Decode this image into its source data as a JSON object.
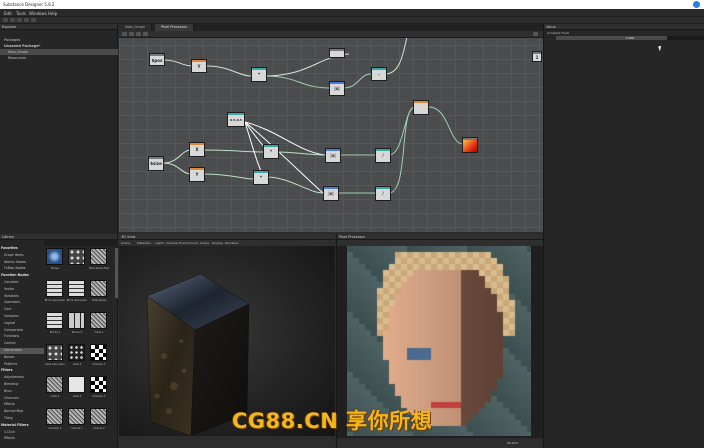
{
  "window": {
    "title": "Substance Designer 5.6.2"
  },
  "menu": [
    "Edit",
    "Tools",
    "Windows",
    "Help"
  ],
  "explorer": {
    "title": "Explorer",
    "items": [
      "Packages",
      "Unsaved Package*",
      "New_Graph",
      "Resources"
    ]
  },
  "tabs": [
    {
      "label": "New_Graph"
    },
    {
      "label": "Pixel Processor"
    }
  ],
  "graph_nodes": [
    {
      "label": "$pos",
      "kind": "input"
    },
    {
      "label": "Y",
      "kind": "swizzle"
    },
    {
      "label": "*",
      "kind": "mul"
    },
    {
      "label": "|x|",
      "kind": "abs"
    },
    {
      "label": "-",
      "kind": "sub"
    },
    {
      "label": "$size",
      "kind": "input"
    },
    {
      "label": "X",
      "kind": "swizzle"
    },
    {
      "label": "Y",
      "kind": "swizzle"
    },
    {
      "label": "*",
      "kind": "mul"
    },
    {
      "label": "*",
      "kind": "mul"
    },
    {
      "label": "|x|",
      "kind": "abs"
    },
    {
      "label": "|x|",
      "kind": "abs"
    },
    {
      "label": "/",
      "kind": "div"
    },
    {
      "label": "/",
      "kind": "div"
    },
    {
      "label": "1",
      "kind": "const"
    }
  ],
  "properties": {
    "title": "Value",
    "param_label": "Constant Float",
    "slider_value": "0.000",
    "slider_fraction": 0.75
  },
  "library": {
    "title": "Library",
    "categories": [
      {
        "label": "Favorites",
        "header": true
      },
      {
        "label": "Graph Items"
      },
      {
        "label": "Atomic Nodes"
      },
      {
        "label": "FxMap Nodes"
      },
      {
        "label": "Function Nodes",
        "header": true
      },
      {
        "label": "Constant"
      },
      {
        "label": "Vector"
      },
      {
        "label": "Variables"
      },
      {
        "label": "Operators"
      },
      {
        "label": "Cast"
      },
      {
        "label": "Samplers"
      },
      {
        "label": "Logical"
      },
      {
        "label": "Comparison"
      },
      {
        "label": "Functions"
      },
      {
        "label": "Control"
      },
      {
        "label": "Generators",
        "selected": true
      },
      {
        "label": "Noises"
      },
      {
        "label": "Patterns"
      },
      {
        "label": "Filters",
        "header": true
      },
      {
        "label": "Adjustments"
      },
      {
        "label": "Blending"
      },
      {
        "label": "Blurs"
      },
      {
        "label": "Channels"
      },
      {
        "label": "Effects"
      },
      {
        "label": "Normal Map"
      },
      {
        "label": "Tiling"
      },
      {
        "label": "Material Filters",
        "header": true
      },
      {
        "label": "1-Click"
      },
      {
        "label": "Effects"
      }
    ],
    "thumbs": [
      {
        "label": "Shape",
        "style": "blue"
      },
      {
        "label": "",
        "style": "dots"
      },
      {
        "label": "Blue Noise Fast",
        "style": "noise"
      },
      {
        "label": "Brick Generator",
        "style": "bricks"
      },
      {
        "label": "Brick Generator",
        "style": "bricks"
      },
      {
        "label": "BnW Spots",
        "style": "noise"
      },
      {
        "label": "Bricks 1",
        "style": "bricks"
      },
      {
        "label": "Bricks 2",
        "style": "bricks2"
      },
      {
        "label": "Cells 1",
        "style": "noise"
      },
      {
        "label": "Cells Generator",
        "style": "dots"
      },
      {
        "label": "Cells 3",
        "style": "cells"
      },
      {
        "label": "Checker 1",
        "style": "checker"
      },
      {
        "label": "Cells 4",
        "style": "noise"
      },
      {
        "label": "Cells 4",
        "style": "white"
      },
      {
        "label": "Checker 1",
        "style": "checker"
      },
      {
        "label": "Checker 1",
        "style": "noise"
      },
      {
        "label": "Clouds 1",
        "style": "noise"
      },
      {
        "label": "Clouds 2",
        "style": "noise"
      }
    ]
  },
  "view3d": {
    "title": "3D View",
    "menu": [
      "Scene",
      "Materials",
      "Lights",
      "Camera",
      "Environment",
      "Scene",
      "Display",
      "Renderer"
    ]
  },
  "view2d": {
    "title": "Pixel Processor",
    "zoom": "68.00%"
  },
  "watermark": "CG88.CN 享你所想"
}
